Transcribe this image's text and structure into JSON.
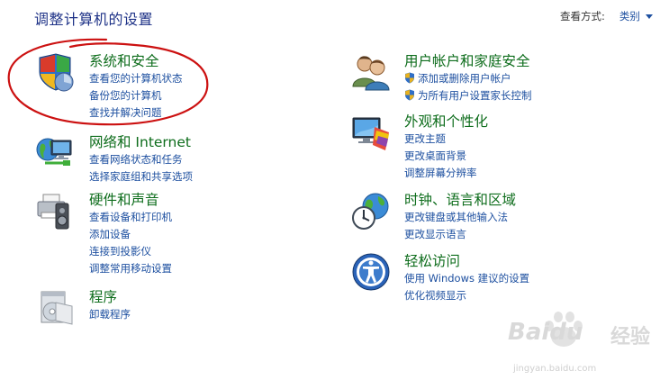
{
  "header": {
    "title": "调整计算机的设置",
    "view_by_label": "查看方式:",
    "view_by_value": "类别"
  },
  "categories": {
    "system": {
      "title": "系统和安全",
      "links": [
        "查看您的计算机状态",
        "备份您的计算机",
        "查找并解决问题"
      ]
    },
    "network": {
      "title": "网络和 Internet",
      "links": [
        "查看网络状态和任务",
        "选择家庭组和共享选项"
      ]
    },
    "hardware": {
      "title": "硬件和声音",
      "links": [
        "查看设备和打印机",
        "添加设备",
        "连接到投影仪",
        "调整常用移动设置"
      ]
    },
    "programs": {
      "title": "程序",
      "links": [
        "卸载程序"
      ]
    },
    "users": {
      "title": "用户帐户和家庭安全",
      "links": [
        "添加或删除用户帐户",
        "为所有用户设置家长控制"
      ]
    },
    "appearance": {
      "title": "外观和个性化",
      "links": [
        "更改主题",
        "更改桌面背景",
        "调整屏幕分辨率"
      ]
    },
    "clock": {
      "title": "时钟、语言和区域",
      "links": [
        "更改键盘或其他输入法",
        "更改显示语言"
      ]
    },
    "ease": {
      "title": "轻松访问",
      "links": [
        "使用 Windows 建议的设置",
        "优化视频显示"
      ]
    }
  },
  "watermark": {
    "brand": "Baidu",
    "subtitle": "经验",
    "url": "jingyan.baidu.com"
  },
  "colors": {
    "title_green": "#0e6d1c",
    "link_blue": "#1e50a0",
    "annotation_red": "#cc1111"
  }
}
